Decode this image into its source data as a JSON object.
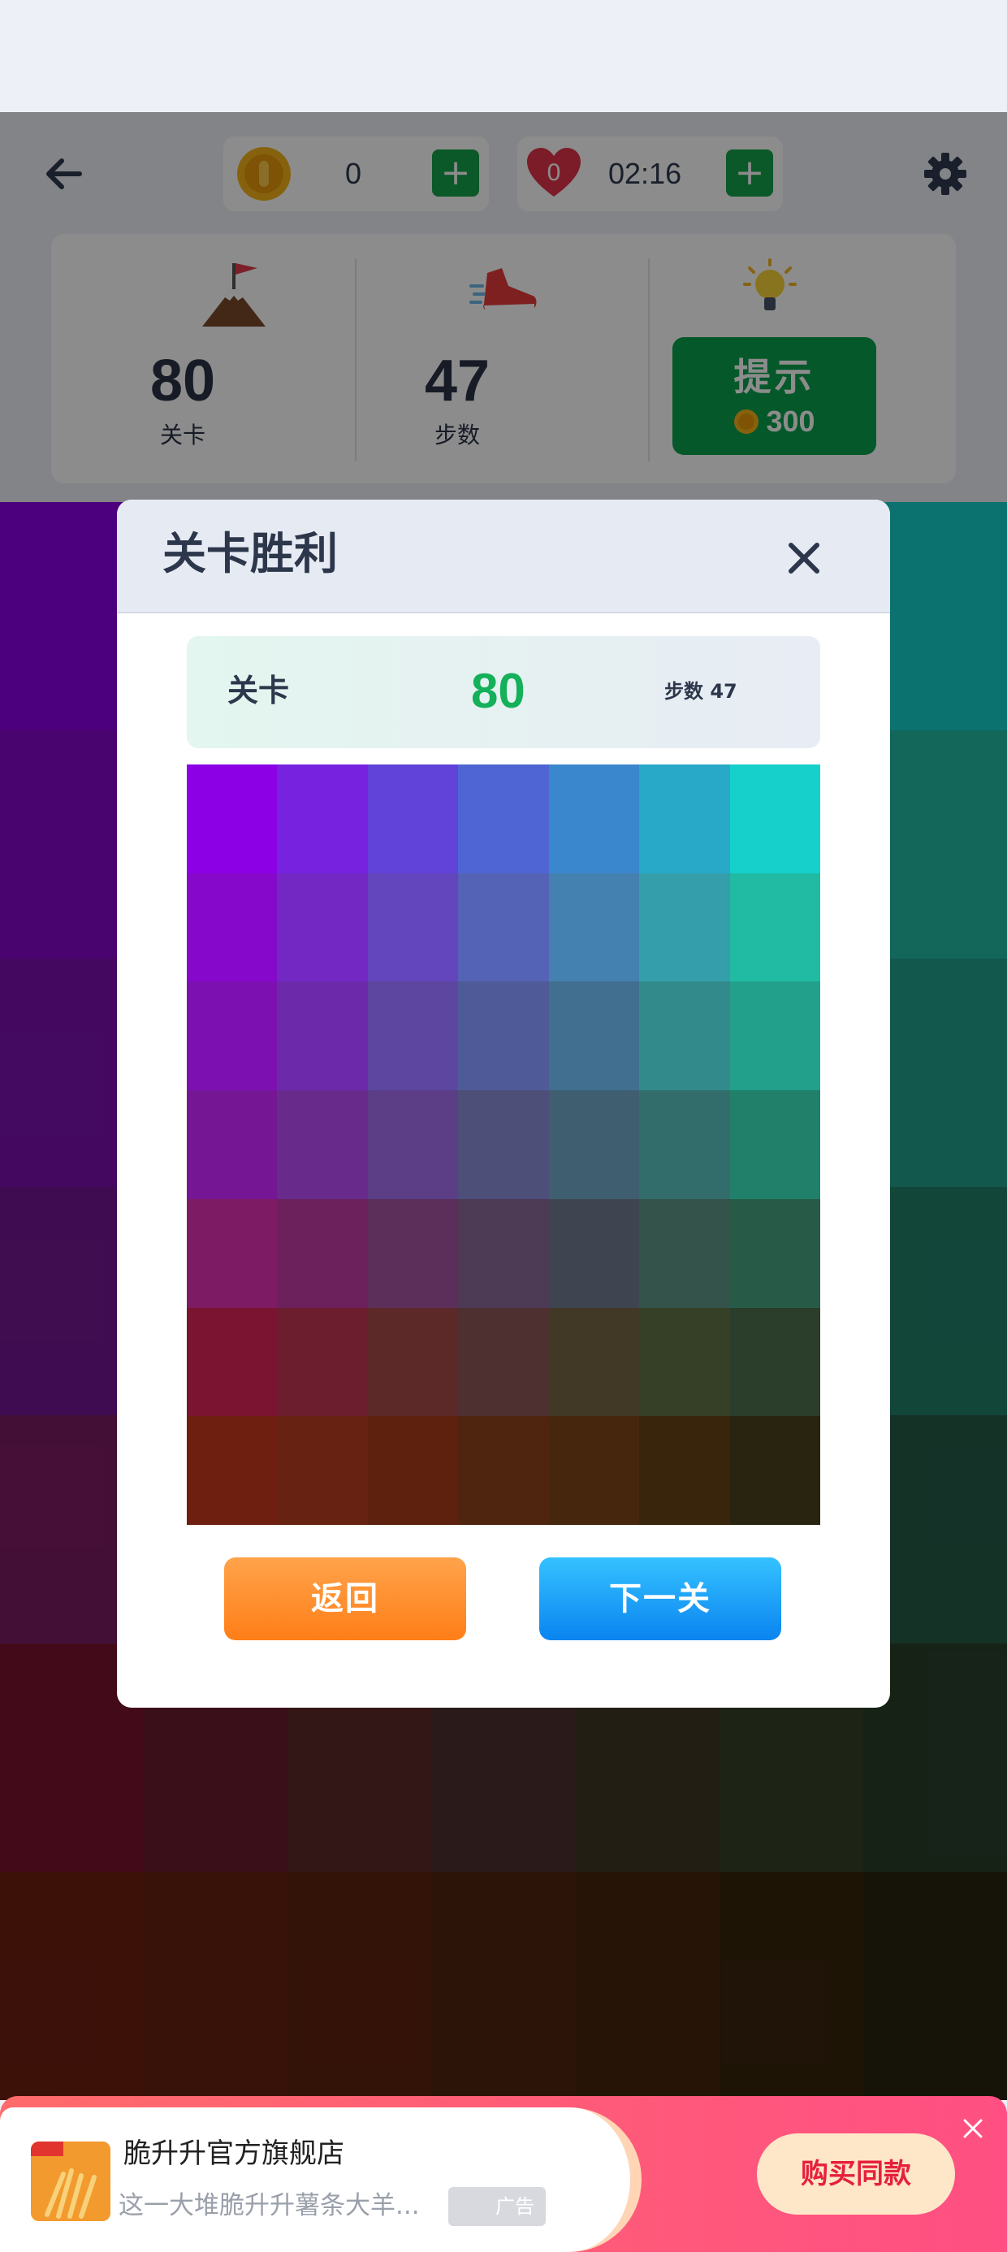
{
  "header": {
    "coins": "0",
    "life_count": "0",
    "life_timer": "02:16",
    "plus_label": "+"
  },
  "stats": {
    "level_value": "80",
    "level_label": "关卡",
    "steps_value": "47",
    "steps_label": "步数",
    "hint_label": "提示",
    "hint_cost": "300"
  },
  "modal": {
    "title": "关卡胜利",
    "level_label": "关卡",
    "level_value": "80",
    "steps_text": "步数 47",
    "return_label": "返回",
    "next_label": "下一关"
  },
  "solved_grid_colors": [
    [
      "#8b00e4",
      "#7622df",
      "#6243d9",
      "#4f65d4",
      "#3b87ce",
      "#28a9c8",
      "#16d0cb"
    ],
    [
      "#8508cb",
      "#7327c3",
      "#6345bd",
      "#5463b5",
      "#4480b0",
      "#349faa",
      "#21bba4"
    ],
    [
      "#7c10b1",
      "#6c2aab",
      "#5d46a0",
      "#4f5b98",
      "#416f8f",
      "#328a8a",
      "#22a08c"
    ],
    [
      "#751794",
      "#682b8c",
      "#5b3e86",
      "#4d4f79",
      "#3f5f70",
      "#326d6b",
      "#218069"
    ],
    [
      "#7d1c64",
      "#6c215c",
      "#5c2f5a",
      "#4d3a55",
      "#3f4550",
      "#34534b",
      "#275b48"
    ],
    [
      "#7a1430",
      "#6c1d2e",
      "#5d2828",
      "#4e3030",
      "#413826",
      "#354027",
      "#2a3e2b"
    ],
    [
      "#6e1f10",
      "#672211",
      "#5e210e",
      "#502510",
      "#46270e",
      "#38250c",
      "#28240f"
    ]
  ],
  "board_colors": [
    [
      "#8b00e4",
      "#7622df",
      "#6243d9",
      "#4f65d4",
      "#3b87ce",
      "#28a9c8",
      "#16d0cb"
    ],
    [
      "#8508cb",
      "#7327c3",
      "#6345bd",
      "#5463b5",
      "#4480b0",
      "#349faa",
      "#21bba4"
    ],
    [
      "#7c10b1",
      "#6c2aab",
      "#5d46a0",
      "#4f5b98",
      "#416f8f",
      "#328a8a",
      "#22a08c"
    ],
    [
      "#751794",
      "#682b8c",
      "#5b3e86",
      "#4d4f79",
      "#3f5f70",
      "#326d6b",
      "#218069"
    ],
    [
      "#7d1c64",
      "#6c215c",
      "#5c2f5a",
      "#4d3a55",
      "#3f4550",
      "#34534b",
      "#275b48"
    ],
    [
      "#7a1430",
      "#6c1d2e",
      "#5d2828",
      "#4e3030",
      "#413826",
      "#354027",
      "#2a3e2b"
    ],
    [
      "#6e1f10",
      "#672211",
      "#5e210e",
      "#502510",
      "#46270e",
      "#38250c",
      "#28240f"
    ]
  ],
  "ad": {
    "title": "脆升升官方旗舰店",
    "description": "这一大堆脆升升薯条大羊...",
    "tag": "广告",
    "buy_label": "购买同款"
  },
  "colors": {
    "hint_green": "#0aa14c",
    "level_green": "#14b05a",
    "return_orange": "#ff7e17",
    "next_blue": "#0a84f0"
  },
  "icons": [
    "back-arrow-icon",
    "gear-icon",
    "coin-icon",
    "heart-icon",
    "mountain-flag-icon",
    "sneaker-icon",
    "lightbulb-icon",
    "close-icon"
  ]
}
